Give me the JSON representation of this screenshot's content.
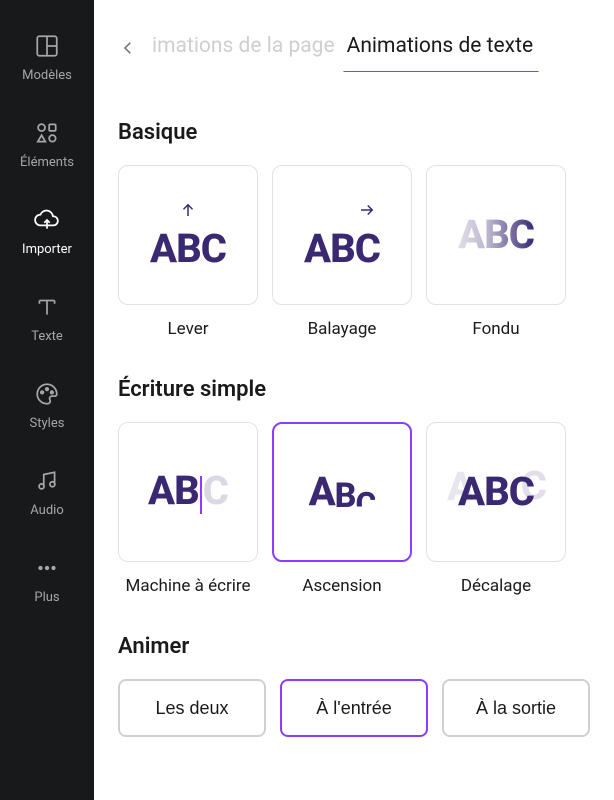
{
  "sidebar": {
    "items": [
      {
        "label": "Modèles",
        "icon": "templates-icon"
      },
      {
        "label": "Éléments",
        "icon": "elements-icon"
      },
      {
        "label": "Importer",
        "icon": "upload-icon",
        "active": true
      },
      {
        "label": "Texte",
        "icon": "text-icon"
      },
      {
        "label": "Styles",
        "icon": "styles-icon"
      },
      {
        "label": "Audio",
        "icon": "audio-icon"
      },
      {
        "label": "Plus",
        "icon": "more-icon"
      }
    ]
  },
  "tabs": {
    "page_animations": "imations de la page",
    "text_animations": "Animations de texte"
  },
  "sections": {
    "basic": {
      "title": "Basique",
      "cards": [
        {
          "label": "Lever"
        },
        {
          "label": "Balayage"
        },
        {
          "label": "Fondu"
        }
      ]
    },
    "simple_writing": {
      "title": "Écriture simple",
      "cards": [
        {
          "label": "Machine à écrire"
        },
        {
          "label": "Ascension",
          "selected": true
        },
        {
          "label": "Décalage"
        }
      ]
    }
  },
  "animate": {
    "title": "Animer",
    "options": [
      {
        "label": "Les deux"
      },
      {
        "label": "À l'entrée",
        "selected": true
      },
      {
        "label": "À la sortie"
      }
    ]
  },
  "preview_text": "ABC"
}
